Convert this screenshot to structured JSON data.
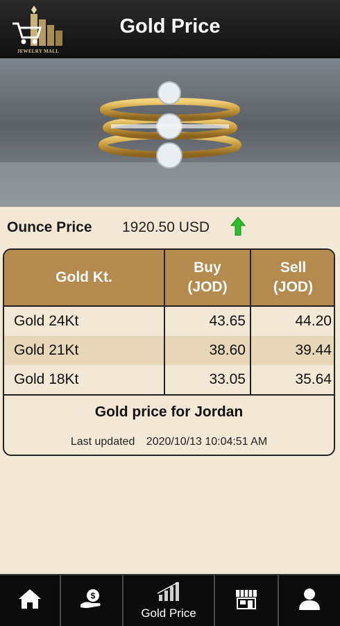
{
  "header": {
    "title": "Gold Price",
    "logo_text": "JEWELRY MALL"
  },
  "ounce": {
    "label": "Ounce Price",
    "value": "1920.50 USD",
    "trend": "up",
    "trend_color": "#2bbf2b"
  },
  "table": {
    "headers": {
      "kt": "Gold Kt.",
      "buy_line1": "Buy",
      "buy_line2": "(JOD)",
      "sell_line1": "Sell",
      "sell_line2": "(JOD)"
    },
    "rows": [
      {
        "kt": "Gold 24Kt",
        "buy": "43.65",
        "sell": "44.20"
      },
      {
        "kt": "Gold 21Kt",
        "buy": "38.60",
        "sell": "39.44"
      },
      {
        "kt": "Gold 18Kt",
        "buy": "33.05",
        "sell": "35.64"
      }
    ],
    "note": "Gold price for Jordan",
    "updated_label": "Last updated",
    "updated_value": "2020/10/13 10:04:51 AM"
  },
  "nav": {
    "items": [
      {
        "icon": "home-icon",
        "label": ""
      },
      {
        "icon": "money-hand-icon",
        "label": ""
      },
      {
        "icon": "bar-chart-icon",
        "label": "Gold Price"
      },
      {
        "icon": "store-icon",
        "label": ""
      },
      {
        "icon": "user-icon",
        "label": ""
      }
    ]
  },
  "colors": {
    "header_bg": "#141414",
    "accent": "#b58a4e",
    "background": "#f3e8d6"
  }
}
